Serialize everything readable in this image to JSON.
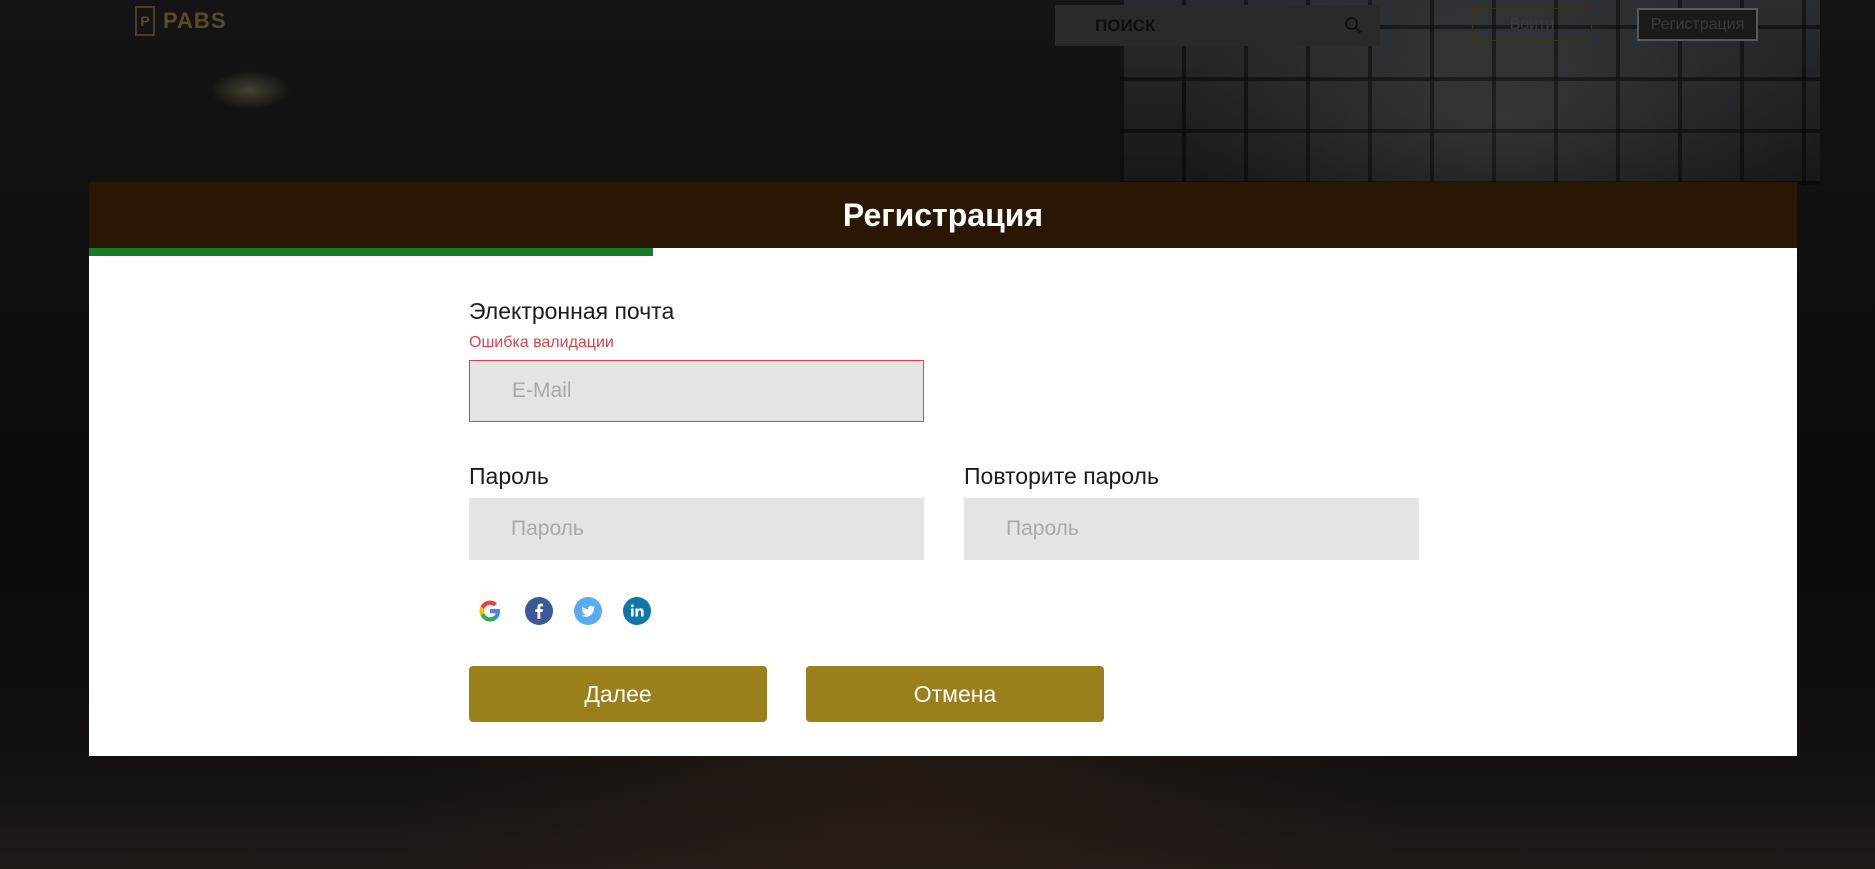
{
  "navbar": {
    "logo_mark": "P",
    "logo_text": "PABS",
    "search_placeholder": "ПОИСК",
    "login_label": "Войти",
    "register_label": "Регистрация"
  },
  "modal": {
    "title": "Регистрация",
    "progress_fraction": 0.33,
    "email": {
      "label": "Электронная почта",
      "error": "Ошибка валидации",
      "placeholder": "E-Mail"
    },
    "password": {
      "label": "Пароль",
      "placeholder": "Пароль"
    },
    "password_repeat": {
      "label": "Повторите пароль",
      "placeholder": "Пароль"
    },
    "social_icons": [
      "google-icon",
      "facebook-icon",
      "twitter-icon",
      "linkedin-icon"
    ],
    "next_label": "Далее",
    "cancel_label": "Отмена"
  },
  "colors": {
    "header_bg": "#2a1703",
    "progress": "#157c2a",
    "button": "#9a7f1b",
    "error": "#d9434c",
    "input_bg": "#e4e4e4"
  }
}
